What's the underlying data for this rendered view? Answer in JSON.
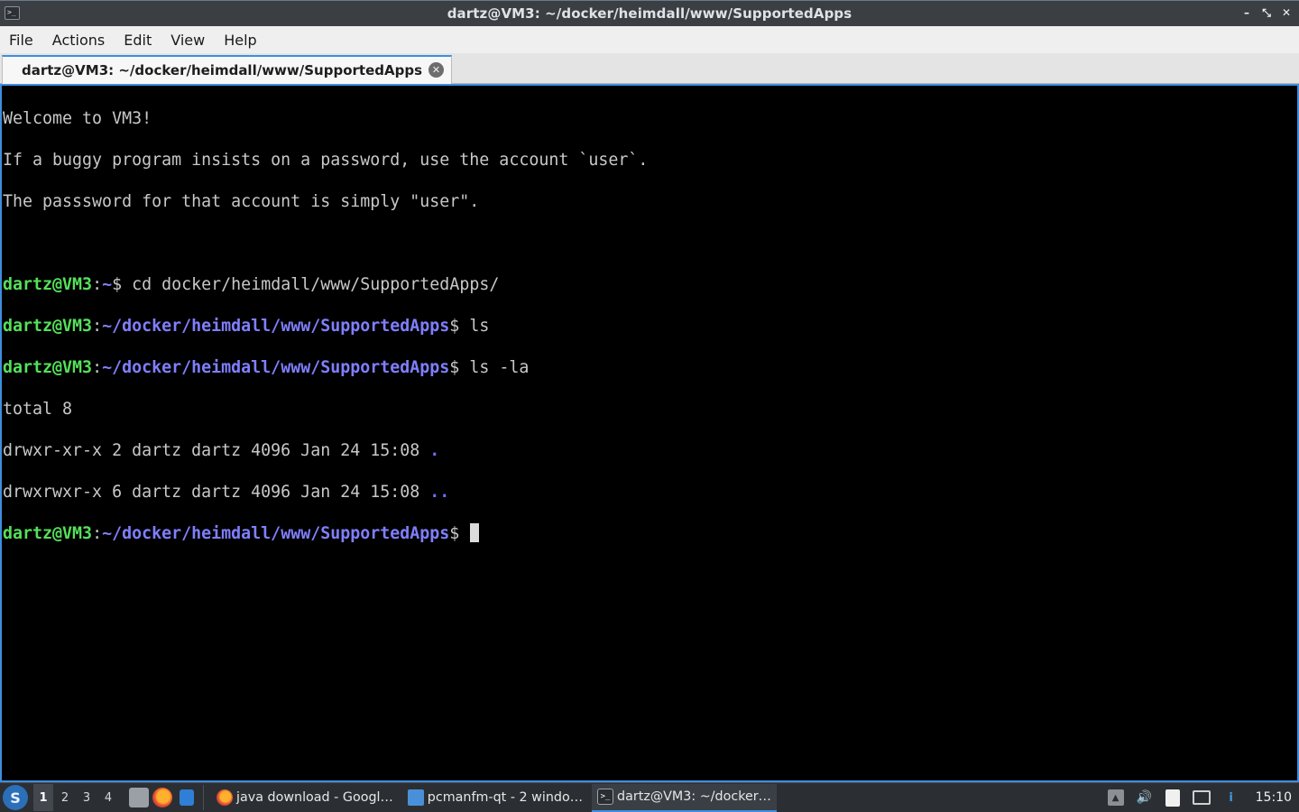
{
  "window": {
    "title": "dartz@VM3: ~/docker/heimdall/www/SupportedApps",
    "app_icon": ">_",
    "controls": {
      "minimize": "–",
      "maximize": "⤡",
      "close": "✕"
    }
  },
  "menu": {
    "items": [
      "File",
      "Actions",
      "Edit",
      "View",
      "Help"
    ]
  },
  "tab": {
    "label": "dartz@VM3: ~/docker/heimdall/www/SupportedApps",
    "close_glyph": "✕"
  },
  "terminal": {
    "welcome": [
      "Welcome to VM3!",
      "If a buggy program insists on a password, use the account `user`.",
      "The passsword for that account is simply \"user\"."
    ],
    "prompt_user": "dartz@VM3",
    "commands": [
      {
        "path": "~",
        "cmd": " cd docker/heimdall/www/SupportedApps/"
      },
      {
        "path": "~/docker/heimdall/www/SupportedApps",
        "cmd": " ls"
      },
      {
        "path": "~/docker/heimdall/www/SupportedApps",
        "cmd": " ls -la"
      }
    ],
    "output": {
      "total": "total 8",
      "rows": [
        {
          "text": "drwxr-xr-x 2 dartz dartz 4096 Jan 24 15:08 ",
          "name": "."
        },
        {
          "text": "drwxrwxr-x 6 dartz dartz 4096 Jan 24 15:08 ",
          "name": ".."
        }
      ]
    },
    "final_prompt_path": "~/docker/heimdall/www/SupportedApps"
  },
  "taskbar": {
    "start_glyph": "S",
    "desktops": [
      "1",
      "2",
      "3",
      "4"
    ],
    "tasks": [
      {
        "label": "java download - Googl…",
        "icon": "firefox-icon"
      },
      {
        "label": "pcmanfm-qt - 2 windo…",
        "icon": "folder-icon"
      },
      {
        "label": "dartz@VM3: ~/docker…",
        "icon": "terminal-icon"
      }
    ],
    "tray": {
      "volume": "🔊",
      "info": "i",
      "upload": "▲"
    },
    "clock": "15:10"
  }
}
